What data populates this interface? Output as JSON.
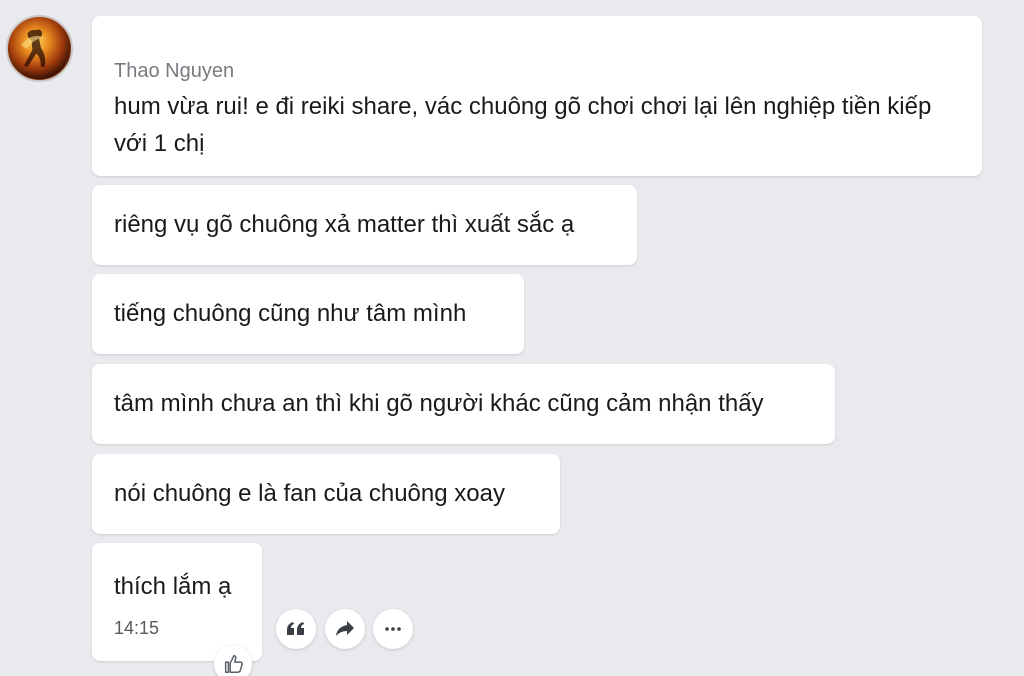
{
  "sender": {
    "name": "Thao Nguyen",
    "avatar_icon": "user-avatar-image"
  },
  "messages": [
    {
      "text": "hum vừa rui! e đi reiki share, vác chuông gõ chơi chơi lại lên nghiệp tiền kiếp với 1 chị"
    },
    {
      "text": "riêng vụ gõ chuông xả matter thì xuất sắc ạ"
    },
    {
      "text": "tiếng chuông cũng như tâm mình"
    },
    {
      "text": "tâm mình chưa an thì khi gõ người khác cũng cảm nhận thấy"
    },
    {
      "text": "nói chuông e là fan của chuông xoay"
    },
    {
      "text": "thích lắm ạ",
      "time": "14:15"
    }
  ],
  "actions": [
    {
      "icon": "quote-icon"
    },
    {
      "icon": "share-arrow-icon"
    },
    {
      "icon": "more-icon"
    }
  ],
  "reaction": {
    "icon": "thumbs-up-icon"
  },
  "colors": {
    "background": "#e9eaee",
    "bubble": "#ffffff",
    "sender_name": "#777b80",
    "timestamp": "#555a60"
  }
}
